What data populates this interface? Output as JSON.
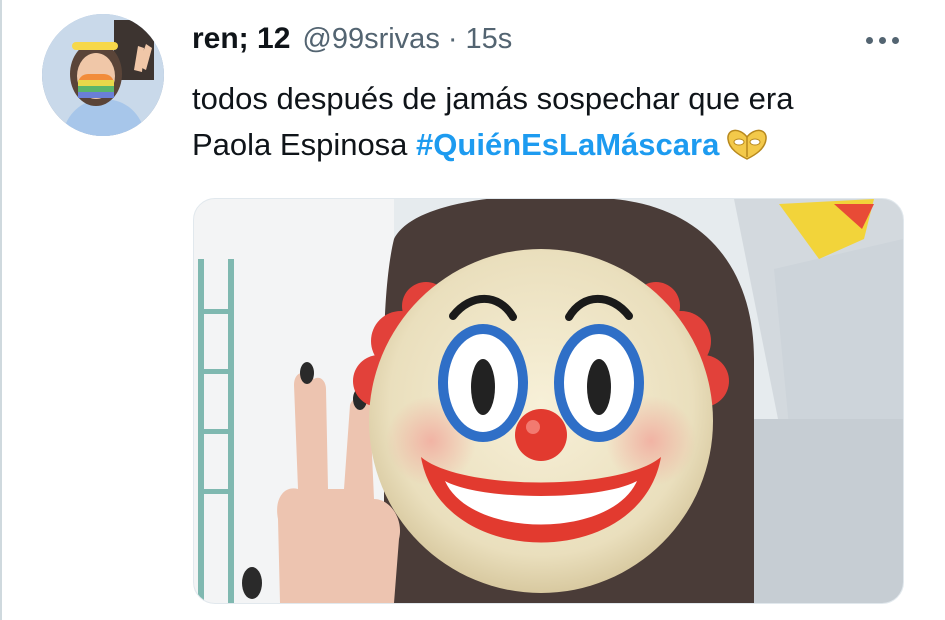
{
  "tweet": {
    "author": {
      "display_name": "ren; 12",
      "handle": "@99srivas",
      "avatar_icon": "profile-photo"
    },
    "separator": "·",
    "timestamp": "15s",
    "more_icon": "more-horizontal-icon",
    "text_line1": "todos después de jamás sospechar que era",
    "text_line2_prefix": "Paola Espinosa ",
    "hashtag": "#QuiénEsLaMáscara",
    "hashtag_emoji": "butterfly-mask-emoji",
    "media": {
      "description_icon": "selfie-with-clown-emoji-face",
      "accent_colors": {
        "clown_hair": "#e2413a",
        "clown_eyes": "#2f6fc7",
        "clown_nose": "#e23a2f",
        "hashtag": "#1d9bf0"
      }
    }
  }
}
